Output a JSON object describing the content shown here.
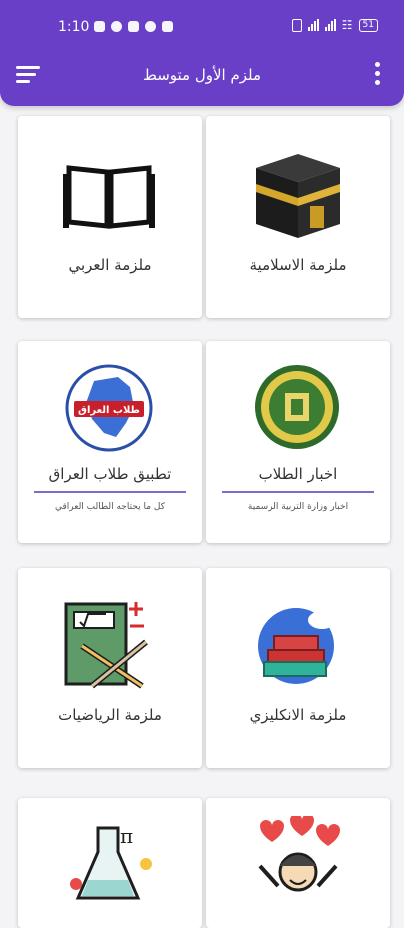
{
  "status_bar": {
    "time": "1:10",
    "battery": "51"
  },
  "app_bar": {
    "title": "ملزم الأول متوسط"
  },
  "cards": {
    "islamic": {
      "label": "ملزمة الاسلامية"
    },
    "arabic": {
      "label": "ملزمة العربي"
    },
    "news": {
      "label": "اخبار الطلاب",
      "sub": "اخبار وزارة التربية الرسمية"
    },
    "iraq_app": {
      "label": "تطبيق طلاب العراق",
      "sub": "كل ما يحتاجه الطالب العراقي",
      "logo_text": "طلاب العراق"
    },
    "english": {
      "label": "ملزمة الانكليزي"
    },
    "math": {
      "label": "ملزمة الرياضيات"
    }
  },
  "colors": {
    "primary": "#6a3fc8",
    "card_bg": "#ffffff",
    "page_bg": "#f4f4f6"
  }
}
